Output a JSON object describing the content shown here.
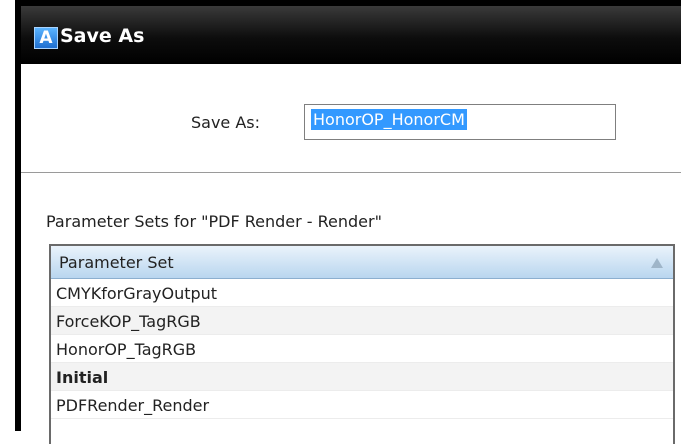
{
  "window": {
    "icon_text": "A",
    "title": "Save As"
  },
  "form": {
    "name_label": "Save As:",
    "name_value": "HonorOP_HonorCM"
  },
  "parameter_sets": {
    "caption": "Parameter Sets for \"PDF Render - Render\"",
    "column_header": "Parameter Set",
    "rows": [
      {
        "name": "CMYKforGrayOutput",
        "bold": false
      },
      {
        "name": "ForceKOP_TagRGB",
        "bold": false
      },
      {
        "name": "HonorOP_TagRGB",
        "bold": false
      },
      {
        "name": "Initial",
        "bold": true
      },
      {
        "name": "PDFRender_Render",
        "bold": false
      }
    ]
  },
  "colors": {
    "titlebar": "#000000",
    "selection": "#3399ff",
    "header_gradient_bottom": "#b9d6ef"
  }
}
